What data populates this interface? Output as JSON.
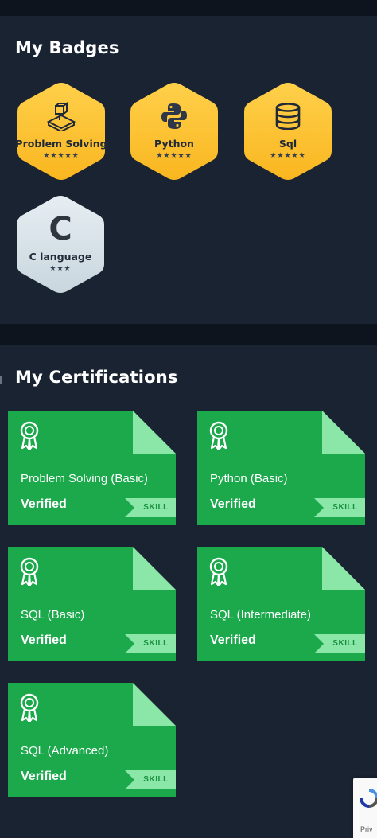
{
  "badges": {
    "title": "My Badges",
    "items": [
      {
        "label": "Problem Solving",
        "stars": "★★★★★",
        "icon": "problem-solving-icon",
        "color": "#ffc12e"
      },
      {
        "label": "Python",
        "stars": "★★★★★",
        "icon": "python-icon",
        "color": "#ffc12e"
      },
      {
        "label": "Sql",
        "stars": "★★★★★",
        "icon": "database-icon",
        "color": "#ffc12e"
      },
      {
        "label": "C language",
        "stars": "★★★",
        "icon": "c-letter-icon",
        "icon_text": "C",
        "color": "#d9e4ea"
      }
    ]
  },
  "certifications": {
    "title": "My Certifications",
    "items": [
      {
        "name": "Problem Solving (Basic)",
        "status": "Verified",
        "tag": "SKILL"
      },
      {
        "name": "Python (Basic)",
        "status": "Verified",
        "tag": "SKILL"
      },
      {
        "name": "SQL (Basic)",
        "status": "Verified",
        "tag": "SKILL"
      },
      {
        "name": "SQL (Intermediate)",
        "status": "Verified",
        "tag": "SKILL"
      },
      {
        "name": "SQL (Advanced)",
        "status": "Verified",
        "tag": "SKILL"
      }
    ]
  },
  "recaptcha": {
    "text": "Priv"
  },
  "colors": {
    "background": "#1a2332",
    "gold": "#ffc12e",
    "silver": "#d9e4ea",
    "cert_green": "#1ba94c",
    "cert_fold": "#8be7a8"
  }
}
